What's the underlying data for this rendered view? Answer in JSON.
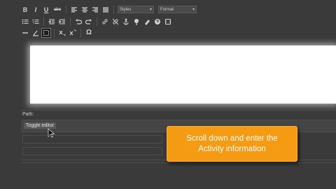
{
  "toolbar": {
    "bold_label": "B",
    "italic_label": "I",
    "underline_label": "U",
    "strike_label": "abc",
    "styles_select": "Styles",
    "format_select": "Format"
  },
  "path_bar": {
    "label": "Path:"
  },
  "toggle_editor": {
    "label": "Toggle editor"
  },
  "callout": {
    "line1": "Scroll down and enter the",
    "line2": "Activity information",
    "color": "#f59a13"
  }
}
